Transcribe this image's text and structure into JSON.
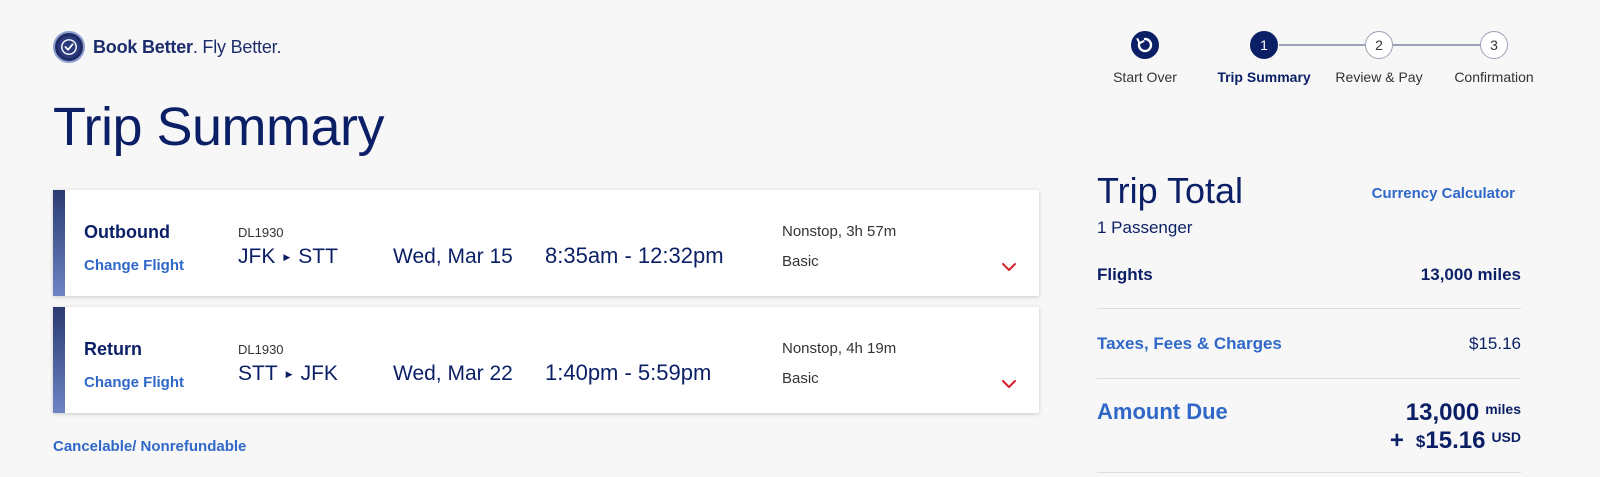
{
  "brand": {
    "name_bold": "Book Better",
    "name_rest": ". Fly Better."
  },
  "stepper": {
    "start_over": "Start Over",
    "steps": [
      {
        "num": "1",
        "label": "Trip Summary",
        "active": true
      },
      {
        "num": "2",
        "label": "Review & Pay",
        "active": false
      },
      {
        "num": "3",
        "label": "Confirmation",
        "active": false
      }
    ]
  },
  "page_title": "Trip Summary",
  "flights": [
    {
      "direction": "Outbound",
      "change_label": "Change Flight",
      "flight_number": "DL1930",
      "origin": "JFK",
      "destination": "STT",
      "date": "Wed, Mar 15",
      "time": "8:35am - 12:32pm",
      "stops": "Nonstop, 3h 57m",
      "fare": "Basic"
    },
    {
      "direction": "Return",
      "change_label": "Change Flight",
      "flight_number": "DL1930",
      "origin": "STT",
      "destination": "JFK",
      "date": "Wed, Mar 22",
      "time": "1:40pm - 5:59pm",
      "stops": "Nonstop, 4h 19m",
      "fare": "Basic"
    }
  ],
  "policy_link": "Cancelable/ Nonrefundable",
  "trip_total": {
    "title": "Trip Total",
    "currency_calculator": "Currency Calculator",
    "passengers": "1 Passenger",
    "flights_label": "Flights",
    "flights_value": "13,000 miles",
    "taxes_label": "Taxes, Fees & Charges",
    "taxes_value": "$15.16",
    "amount_due_label": "Amount Due",
    "due_miles": "13,000",
    "due_miles_unit": "miles",
    "due_plus": "+",
    "due_dollar_sign": "$",
    "due_cash": "15.16",
    "due_cash_unit": "USD"
  },
  "colors": {
    "navy": "#0b1f66",
    "link_blue": "#2f68c8",
    "alert_red": "#d4202c"
  },
  "icons": {
    "start_over": "refresh-icon",
    "expand": "chevron-down-icon",
    "route_arrow": "triangle-right-icon"
  }
}
